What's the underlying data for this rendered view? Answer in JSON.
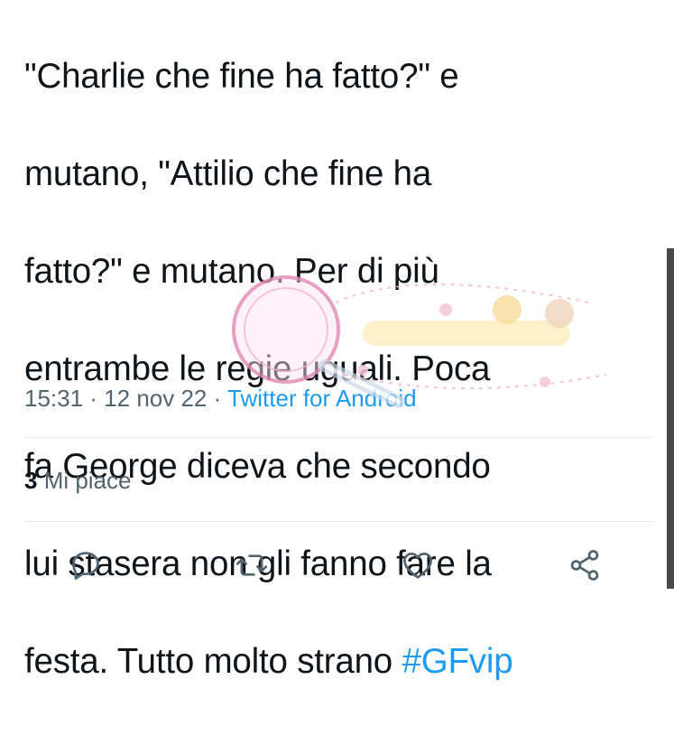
{
  "tweet": {
    "lines": [
      "\"Charlie che fine ha fatto?\" e",
      "mutano, \"Attilio che fine ha",
      "fatto?\" e mutano. Per di più",
      "entrambe le regie uguali. Poca",
      "fa George diceva che secondo",
      "lui stasera non gli fanno fare la",
      "festa. Tutto molto strano "
    ],
    "hashtag": "#GFvip"
  },
  "meta": {
    "time": "15:31",
    "separator1": " · ",
    "date": "12 nov 22",
    "separator2": " · ",
    "source": "Twitter for Android"
  },
  "stats": {
    "likes_count": "3",
    "likes_label": " Mi piace"
  },
  "actions": {
    "reply_icon": "reply-icon",
    "retweet_icon": "retweet-icon",
    "like_icon": "heart-icon",
    "share_icon": "share-icon"
  },
  "colors": {
    "text": "#0f1419",
    "secondary": "#536471",
    "link": "#1d9bf0",
    "divider": "#e6e9eb",
    "watermark_pink": "#e38fb8"
  }
}
